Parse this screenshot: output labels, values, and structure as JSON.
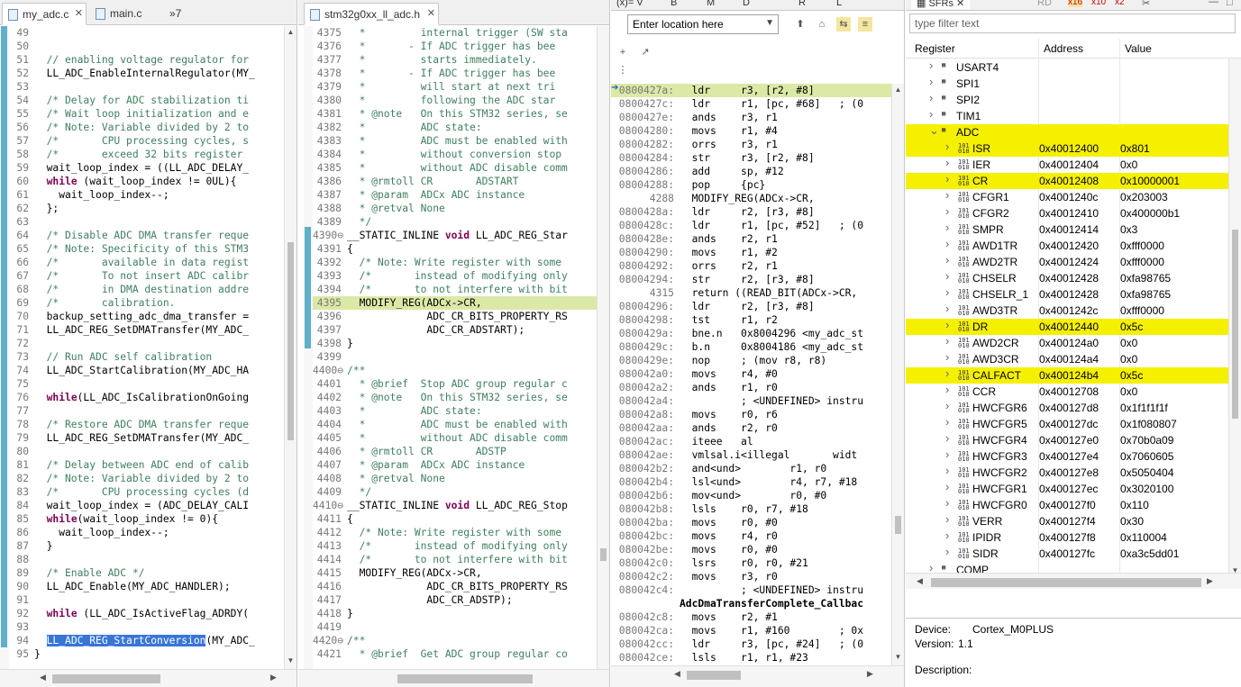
{
  "editor1": {
    "tabs": [
      {
        "label": "my_adc.c",
        "active": true,
        "closable": true
      },
      {
        "label": "main.c",
        "active": false
      },
      {
        "label": "»7",
        "active": false
      }
    ],
    "lines": [
      {
        "n": "49",
        "t": ""
      },
      {
        "n": "50",
        "t": ""
      },
      {
        "n": "51",
        "t": "  // enabling voltage regulator for",
        "c": "cmt"
      },
      {
        "n": "52",
        "t": "  LL_ADC_EnableInternalRegulator(MY_"
      },
      {
        "n": "53",
        "t": ""
      },
      {
        "n": "54",
        "t": "  /* Delay for ADC stabilization ti",
        "c": "cmt"
      },
      {
        "n": "55",
        "t": "  /* Wait loop initialization and e",
        "c": "cmt"
      },
      {
        "n": "56",
        "t": "  /* Note: Variable divided by 2 to",
        "c": "cmt"
      },
      {
        "n": "57",
        "t": "  /*       CPU processing cycles, s",
        "c": "cmt"
      },
      {
        "n": "58",
        "t": "  /*       exceed 32 bits register ",
        "c": "cmt"
      },
      {
        "n": "59",
        "t": "  wait_loop_index = ((LL_ADC_DELAY_"
      },
      {
        "n": "60",
        "t": "  while (wait_loop_index != 0UL){",
        "k": "while"
      },
      {
        "n": "61",
        "t": "    wait_loop_index--;"
      },
      {
        "n": "62",
        "t": "  };"
      },
      {
        "n": "63",
        "t": ""
      },
      {
        "n": "64",
        "t": "  /* Disable ADC DMA transfer reque",
        "c": "cmt"
      },
      {
        "n": "65",
        "t": "  /* Note: Specificity of this STM3",
        "c": "cmt"
      },
      {
        "n": "66",
        "t": "  /*       available in data regist",
        "c": "cmt"
      },
      {
        "n": "67",
        "t": "  /*       To not insert ADC calibr",
        "c": "cmt"
      },
      {
        "n": "68",
        "t": "  /*       in DMA destination addre",
        "c": "cmt"
      },
      {
        "n": "69",
        "t": "  /*       calibration.",
        "c": "cmt"
      },
      {
        "n": "70",
        "t": "  backup_setting_adc_dma_transfer ="
      },
      {
        "n": "71",
        "t": "  LL_ADC_REG_SetDMATransfer(MY_ADC_"
      },
      {
        "n": "72",
        "t": ""
      },
      {
        "n": "73",
        "t": "  // Run ADC self calibration",
        "c": "cmt"
      },
      {
        "n": "74",
        "t": "  LL_ADC_StartCalibration(MY_ADC_HA"
      },
      {
        "n": "75",
        "t": ""
      },
      {
        "n": "76",
        "t": "  while(LL_ADC_IsCalibrationOnGoing",
        "k": "while"
      },
      {
        "n": "77",
        "t": ""
      },
      {
        "n": "78",
        "t": "  /* Restore ADC DMA transfer reque",
        "c": "cmt"
      },
      {
        "n": "79",
        "t": "  LL_ADC_REG_SetDMATransfer(MY_ADC_"
      },
      {
        "n": "80",
        "t": ""
      },
      {
        "n": "81",
        "t": "  /* Delay between ADC end of calib",
        "c": "cmt"
      },
      {
        "n": "82",
        "t": "  /* Note: Variable divided by 2 to",
        "c": "cmt"
      },
      {
        "n": "83",
        "t": "  /*       CPU processing cycles (d",
        "c": "cmt"
      },
      {
        "n": "84",
        "t": "  wait_loop_index = (ADC_DELAY_CALI"
      },
      {
        "n": "85",
        "t": "  while(wait_loop_index != 0){",
        "k": "while"
      },
      {
        "n": "86",
        "t": "    wait_loop_index--;"
      },
      {
        "n": "87",
        "t": "  }"
      },
      {
        "n": "88",
        "t": ""
      },
      {
        "n": "89",
        "t": "  /* Enable ADC */",
        "c": "cmt"
      },
      {
        "n": "90",
        "t": "  LL_ADC_Enable(MY_ADC_HANDLER);"
      },
      {
        "n": "91",
        "t": ""
      },
      {
        "n": "92",
        "t": "  while (LL_ADC_IsActiveFlag_ADRDY(",
        "k": "while"
      },
      {
        "n": "93",
        "t": ""
      },
      {
        "n": "94",
        "t": "  LL_ADC_REG_StartConversion(MY_ADC_",
        "sel": "LL_ADC_REG_StartConversion"
      },
      {
        "n": "95",
        "t": "}"
      }
    ]
  },
  "editor2": {
    "tabs": [
      {
        "label": "stm32g0xx_ll_adc.h",
        "active": true,
        "closable": true
      }
    ],
    "lines": [
      {
        "n": "4375",
        "t": "  *         internal trigger (SW sta",
        "c": "cmt"
      },
      {
        "n": "4376",
        "t": "  *       - If ADC trigger has bee",
        "c": "cmt"
      },
      {
        "n": "4377",
        "t": "  *         starts immediately.",
        "c": "cmt"
      },
      {
        "n": "4378",
        "t": "  *       - If ADC trigger has bee",
        "c": "cmt"
      },
      {
        "n": "4379",
        "t": "  *         will start at next tri",
        "c": "cmt"
      },
      {
        "n": "4380",
        "t": "  *         following the ADC star",
        "c": "cmt"
      },
      {
        "n": "4381",
        "t": "  * @note   On this STM32 series, se",
        "c": "cmt"
      },
      {
        "n": "4382",
        "t": "  *         ADC state:",
        "c": "cmt"
      },
      {
        "n": "4383",
        "t": "  *         ADC must be enabled with",
        "c": "cmt"
      },
      {
        "n": "4384",
        "t": "  *         without conversion stop ",
        "c": "cmt"
      },
      {
        "n": "4385",
        "t": "  *         without ADC disable comm",
        "c": "cmt"
      },
      {
        "n": "4386",
        "t": "  * @rmtoll CR       ADSTART",
        "c": "cmt"
      },
      {
        "n": "4387",
        "t": "  * @param  ADCx ADC instance",
        "c": "cmt"
      },
      {
        "n": "4388",
        "t": "  * @retval None",
        "c": "cmt"
      },
      {
        "n": "4389",
        "t": "  */",
        "c": "cmt"
      },
      {
        "n": "4390⊖",
        "t": "__STATIC_INLINE void LL_ADC_REG_Star",
        "k": "void"
      },
      {
        "n": "4391",
        "t": "{"
      },
      {
        "n": "4392",
        "t": "  /* Note: Write register with some ",
        "c": "cmt"
      },
      {
        "n": "4393",
        "t": "  /*       instead of modifying only",
        "c": "cmt"
      },
      {
        "n": "4394",
        "t": "  /*       to not interfere with bit",
        "c": "cmt"
      },
      {
        "n": "4395",
        "t": "  MODIFY_REG(ADCx->CR,",
        "cur": true
      },
      {
        "n": "4396",
        "t": "             ADC_CR_BITS_PROPERTY_RS"
      },
      {
        "n": "4397",
        "t": "             ADC_CR_ADSTART);"
      },
      {
        "n": "4398",
        "t": "}"
      },
      {
        "n": "4399",
        "t": ""
      },
      {
        "n": "4400⊖",
        "t": "/**",
        "c": "cmt"
      },
      {
        "n": "4401",
        "t": "  * @brief  Stop ADC group regular c",
        "c": "cmt"
      },
      {
        "n": "4402",
        "t": "  * @note   On this STM32 series, se",
        "c": "cmt"
      },
      {
        "n": "4403",
        "t": "  *         ADC state:",
        "c": "cmt"
      },
      {
        "n": "4404",
        "t": "  *         ADC must be enabled with",
        "c": "cmt"
      },
      {
        "n": "4405",
        "t": "  *         without ADC disable comm",
        "c": "cmt"
      },
      {
        "n": "4406",
        "t": "  * @rmtoll CR       ADSTP",
        "c": "cmt"
      },
      {
        "n": "4407",
        "t": "  * @param  ADCx ADC instance",
        "c": "cmt"
      },
      {
        "n": "4408",
        "t": "  * @retval None",
        "c": "cmt"
      },
      {
        "n": "4409",
        "t": "  */",
        "c": "cmt"
      },
      {
        "n": "4410⊖",
        "t": "__STATIC_INLINE void LL_ADC_REG_Stop",
        "k": "void"
      },
      {
        "n": "4411",
        "t": "{"
      },
      {
        "n": "4412",
        "t": "  /* Note: Write register with some ",
        "c": "cmt"
      },
      {
        "n": "4413",
        "t": "  /*       instead of modifying only",
        "c": "cmt"
      },
      {
        "n": "4414",
        "t": "  /*       to not interfere with bit",
        "c": "cmt"
      },
      {
        "n": "4415",
        "t": "  MODIFY_REG(ADCx->CR,"
      },
      {
        "n": "4416",
        "t": "             ADC_CR_BITS_PROPERTY_RS"
      },
      {
        "n": "4417",
        "t": "             ADC_CR_ADSTP);"
      },
      {
        "n": "4418",
        "t": "}"
      },
      {
        "n": "4419",
        "t": ""
      },
      {
        "n": "4420⊖",
        "t": "/**",
        "c": "cmt"
      },
      {
        "n": "4421",
        "t": "  * @brief  Get ADC group regular co",
        "c": "cmt"
      }
    ]
  },
  "disasm": {
    "tabs": [
      "(x)= V",
      "B",
      "M",
      "D",
      "R",
      "L"
    ],
    "location_placeholder": "Enter location here",
    "lines": [
      {
        "a": "0800427a:",
        "t": "  ldr     r3, [r2, #8]",
        "cur": true
      },
      {
        "a": "0800427c:",
        "t": "  ldr     r1, [pc, #68]   ; (0"
      },
      {
        "a": "0800427e:",
        "t": "  ands    r3, r1"
      },
      {
        "a": "08004280:",
        "t": "  movs    r1, #4"
      },
      {
        "a": "08004282:",
        "t": "  orrs    r3, r1"
      },
      {
        "a": "08004284:",
        "t": "  str     r3, [r2, #8]"
      },
      {
        "a": "08004286:",
        "t": "  add     sp, #12"
      },
      {
        "a": "08004288:",
        "t": "  pop     {pc}"
      },
      {
        "a": "4288",
        "t": "  MODIFY_REG(ADCx->CR,"
      },
      {
        "a": "0800428a:",
        "t": "  ldr     r2, [r3, #8]"
      },
      {
        "a": "0800428c:",
        "t": "  ldr     r1, [pc, #52]   ; (0"
      },
      {
        "a": "0800428e:",
        "t": "  ands    r2, r1"
      },
      {
        "a": "08004290:",
        "t": "  movs    r1, #2"
      },
      {
        "a": "08004292:",
        "t": "  orrs    r2, r1"
      },
      {
        "a": "08004294:",
        "t": "  str     r2, [r3, #8]"
      },
      {
        "a": "4315",
        "t": "  return ((READ_BIT(ADCx->CR,"
      },
      {
        "a": "08004296:",
        "t": "  ldr     r2, [r3, #8]"
      },
      {
        "a": "08004298:",
        "t": "  tst     r1, r2"
      },
      {
        "a": "0800429a:",
        "t": "  bne.n   0x8004296 <my_adc_st"
      },
      {
        "a": "0800429c:",
        "t": "  b.n     0x8004186 <my_adc_st"
      },
      {
        "a": "0800429e:",
        "t": "  nop     ; (mov r8, r8)"
      },
      {
        "a": "080042a0:",
        "t": "  movs    r4, #0"
      },
      {
        "a": "080042a2:",
        "t": "  ands    r1, r0"
      },
      {
        "a": "080042a4:",
        "t": "          ; <UNDEFINED> instru"
      },
      {
        "a": "080042a8:",
        "t": "  movs    r0, r6"
      },
      {
        "a": "080042aa:",
        "t": "  ands    r2, r0"
      },
      {
        "a": "080042ac:",
        "t": "  iteee   al"
      },
      {
        "a": "080042ae:",
        "t": "  vmlsal.i<illegal       widt"
      },
      {
        "a": "080042b2:",
        "t": "  and<und>        r1, r0"
      },
      {
        "a": "080042b4:",
        "t": "  lsl<und>        r4, r7, #18"
      },
      {
        "a": "080042b6:",
        "t": "  mov<und>        r0, #0"
      },
      {
        "a": "080042b8:",
        "t": "  lsls    r0, r7, #18"
      },
      {
        "a": "080042ba:",
        "t": "  movs    r0, #0"
      },
      {
        "a": "080042bc:",
        "t": "  movs    r4, r0"
      },
      {
        "a": "080042be:",
        "t": "  movs    r0, #0"
      },
      {
        "a": "080042c0:",
        "t": "  lsrs    r0, r0, #21"
      },
      {
        "a": "080042c2:",
        "t": "  movs    r3, r0"
      },
      {
        "a": "080042c4:",
        "t": "          ; <UNDEFINED> instru"
      },
      {
        "a": "",
        "t": "AdcDmaTransferComplete_Callbac",
        "bold": true
      },
      {
        "a": "080042c8:",
        "t": "  movs    r2, #1"
      },
      {
        "a": "080042ca:",
        "t": "  movs    r1, #160        ; 0x"
      },
      {
        "a": "080042cc:",
        "t": "  ldr     r3, [pc, #24]   ; (0"
      },
      {
        "a": "080042ce:",
        "t": "  lsls    r1, r1, #23"
      }
    ]
  },
  "sfr": {
    "tab_label": "SFRs",
    "filter_placeholder": "type filter text",
    "toolbar": [
      "RD",
      "x16",
      "x10",
      "x2"
    ],
    "columns": {
      "register": "Register",
      "address": "Address",
      "value": "Value"
    },
    "rows": [
      {
        "name": "USART4",
        "level": 0,
        "expand": "right",
        "group": true
      },
      {
        "name": "SPI1",
        "level": 0,
        "expand": "right",
        "group": true
      },
      {
        "name": "SPI2",
        "level": 0,
        "expand": "right",
        "group": true
      },
      {
        "name": "TIM1",
        "level": 0,
        "expand": "right",
        "group": true
      },
      {
        "name": "ADC",
        "level": 0,
        "expand": "down",
        "group": true,
        "hl": true
      },
      {
        "name": "ISR",
        "address": "0x40012400",
        "value": "0x801",
        "level": 1,
        "hl": true
      },
      {
        "name": "IER",
        "address": "0x40012404",
        "value": "0x0",
        "level": 1
      },
      {
        "name": "CR",
        "address": "0x40012408",
        "value": "0x10000001",
        "level": 1,
        "hl": true
      },
      {
        "name": "CFGR1",
        "address": "0x4001240c",
        "value": "0x203003",
        "level": 1
      },
      {
        "name": "CFGR2",
        "address": "0x40012410",
        "value": "0x400000b1",
        "level": 1
      },
      {
        "name": "SMPR",
        "address": "0x40012414",
        "value": "0x3",
        "level": 1
      },
      {
        "name": "AWD1TR",
        "address": "0x40012420",
        "value": "0xfff0000",
        "level": 1
      },
      {
        "name": "AWD2TR",
        "address": "0x40012424",
        "value": "0xfff0000",
        "level": 1
      },
      {
        "name": "CHSELR",
        "address": "0x40012428",
        "value": "0xfa98765",
        "level": 1
      },
      {
        "name": "CHSELR_1",
        "address": "0x40012428",
        "value": "0xfa98765",
        "level": 1
      },
      {
        "name": "AWD3TR",
        "address": "0x4001242c",
        "value": "0xfff0000",
        "level": 1
      },
      {
        "name": "DR",
        "address": "0x40012440",
        "value": "0x5c",
        "level": 1,
        "hl": true
      },
      {
        "name": "AWD2CR",
        "address": "0x400124a0",
        "value": "0x0",
        "level": 1
      },
      {
        "name": "AWD3CR",
        "address": "0x400124a4",
        "value": "0x0",
        "level": 1
      },
      {
        "name": "CALFACT",
        "address": "0x400124b4",
        "value": "0x5c",
        "level": 1,
        "hl": true
      },
      {
        "name": "CCR",
        "address": "0x40012708",
        "value": "0x0",
        "level": 1
      },
      {
        "name": "HWCFGR6",
        "address": "0x400127d8",
        "value": "0x1f1f1f1f",
        "level": 1
      },
      {
        "name": "HWCFGR5",
        "address": "0x400127dc",
        "value": "0x1f080807",
        "level": 1
      },
      {
        "name": "HWCFGR4",
        "address": "0x400127e0",
        "value": "0x70b0a09",
        "level": 1
      },
      {
        "name": "HWCFGR3",
        "address": "0x400127e4",
        "value": "0x7060605",
        "level": 1
      },
      {
        "name": "HWCFGR2",
        "address": "0x400127e8",
        "value": "0x5050404",
        "level": 1
      },
      {
        "name": "HWCFGR1",
        "address": "0x400127ec",
        "value": "0x3020100",
        "level": 1
      },
      {
        "name": "HWCFGR0",
        "address": "0x400127f0",
        "value": "0x110",
        "level": 1
      },
      {
        "name": "VERR",
        "address": "0x400127f4",
        "value": "0x30",
        "level": 1
      },
      {
        "name": "IPIDR",
        "address": "0x400127f8",
        "value": "0x110004",
        "level": 1
      },
      {
        "name": "SIDR",
        "address": "0x400127fc",
        "value": "0xa3c5dd01",
        "level": 1
      },
      {
        "name": "COMP",
        "level": 0,
        "expand": "right",
        "group": true
      }
    ],
    "device_label": "Device:",
    "device_value": "Cortex_M0PLUS",
    "version_label": "Version:",
    "version_value": "1.1",
    "description_label": "Description:"
  },
  "colors": {
    "highlight_yellow": "#f5f000",
    "comment_green": "#3f7f5f",
    "keyword_purple": "#7f0055",
    "current_line": "#dbe9a6"
  }
}
